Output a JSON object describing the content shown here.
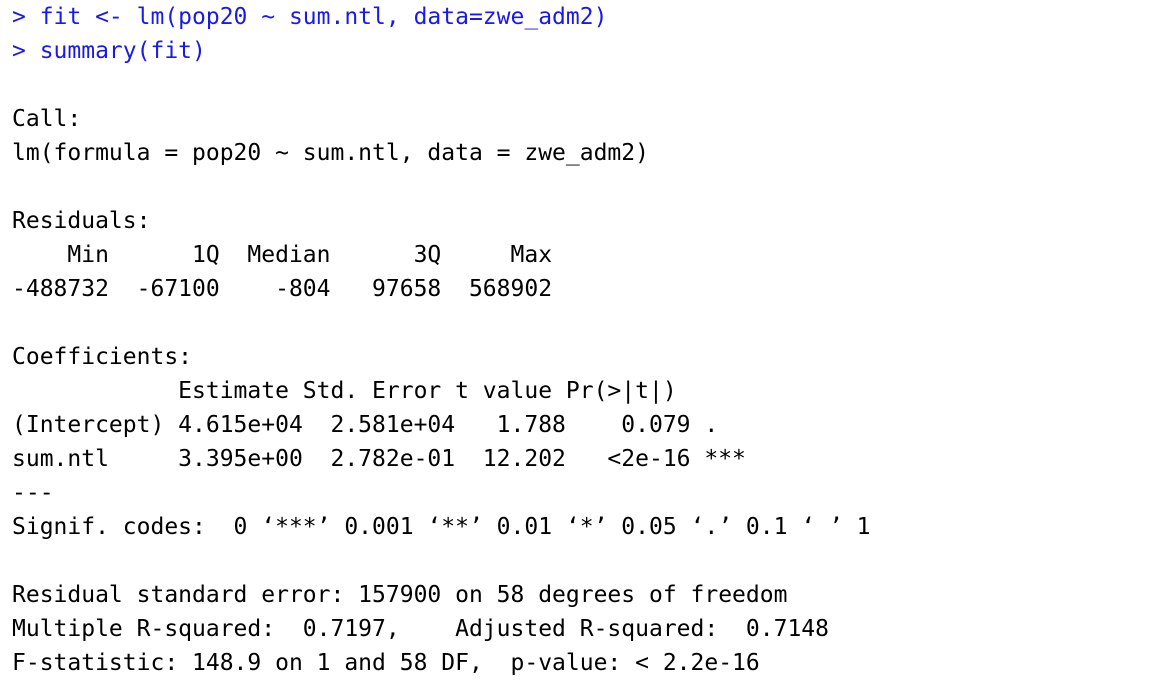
{
  "colors": {
    "command": "#1a1ae6",
    "output": "#000000",
    "background": "#ffffff"
  },
  "commands": [
    "> fit <- lm(pop20 ~ sum.ntl, data=zwe_adm2)",
    "> summary(fit)"
  ],
  "output": {
    "call_header": "Call:",
    "call_formula": "lm(formula = pop20 ~ sum.ntl, data = zwe_adm2)",
    "residuals_header": "Residuals:",
    "residuals_labels": "    Min      1Q  Median      3Q     Max ",
    "residuals_values": "-488732  -67100    -804   97658  568902 ",
    "coefficients_header": "Coefficients:",
    "coef_col_headers": "            Estimate Std. Error t value Pr(>|t|)    ",
    "coef_row_intercept": "(Intercept) 4.615e+04  2.581e+04   1.788    0.079 .  ",
    "coef_row_sumntl": "sum.ntl     3.395e+00  2.782e-01  12.202   <2e-16 ***",
    "separator": "---",
    "signif_codes": "Signif. codes:  0 ‘***’ 0.001 ‘**’ 0.01 ‘*’ 0.05 ‘.’ 0.1 ‘ ’ 1",
    "residual_se": "Residual standard error: 157900 on 58 degrees of freedom",
    "r_squared": "Multiple R-squared:  0.7197,\tAdjusted R-squared:  0.7148 ",
    "f_statistic": "F-statistic: 148.9 on 1 and 58 DF,  p-value: < 2.2e-16"
  }
}
